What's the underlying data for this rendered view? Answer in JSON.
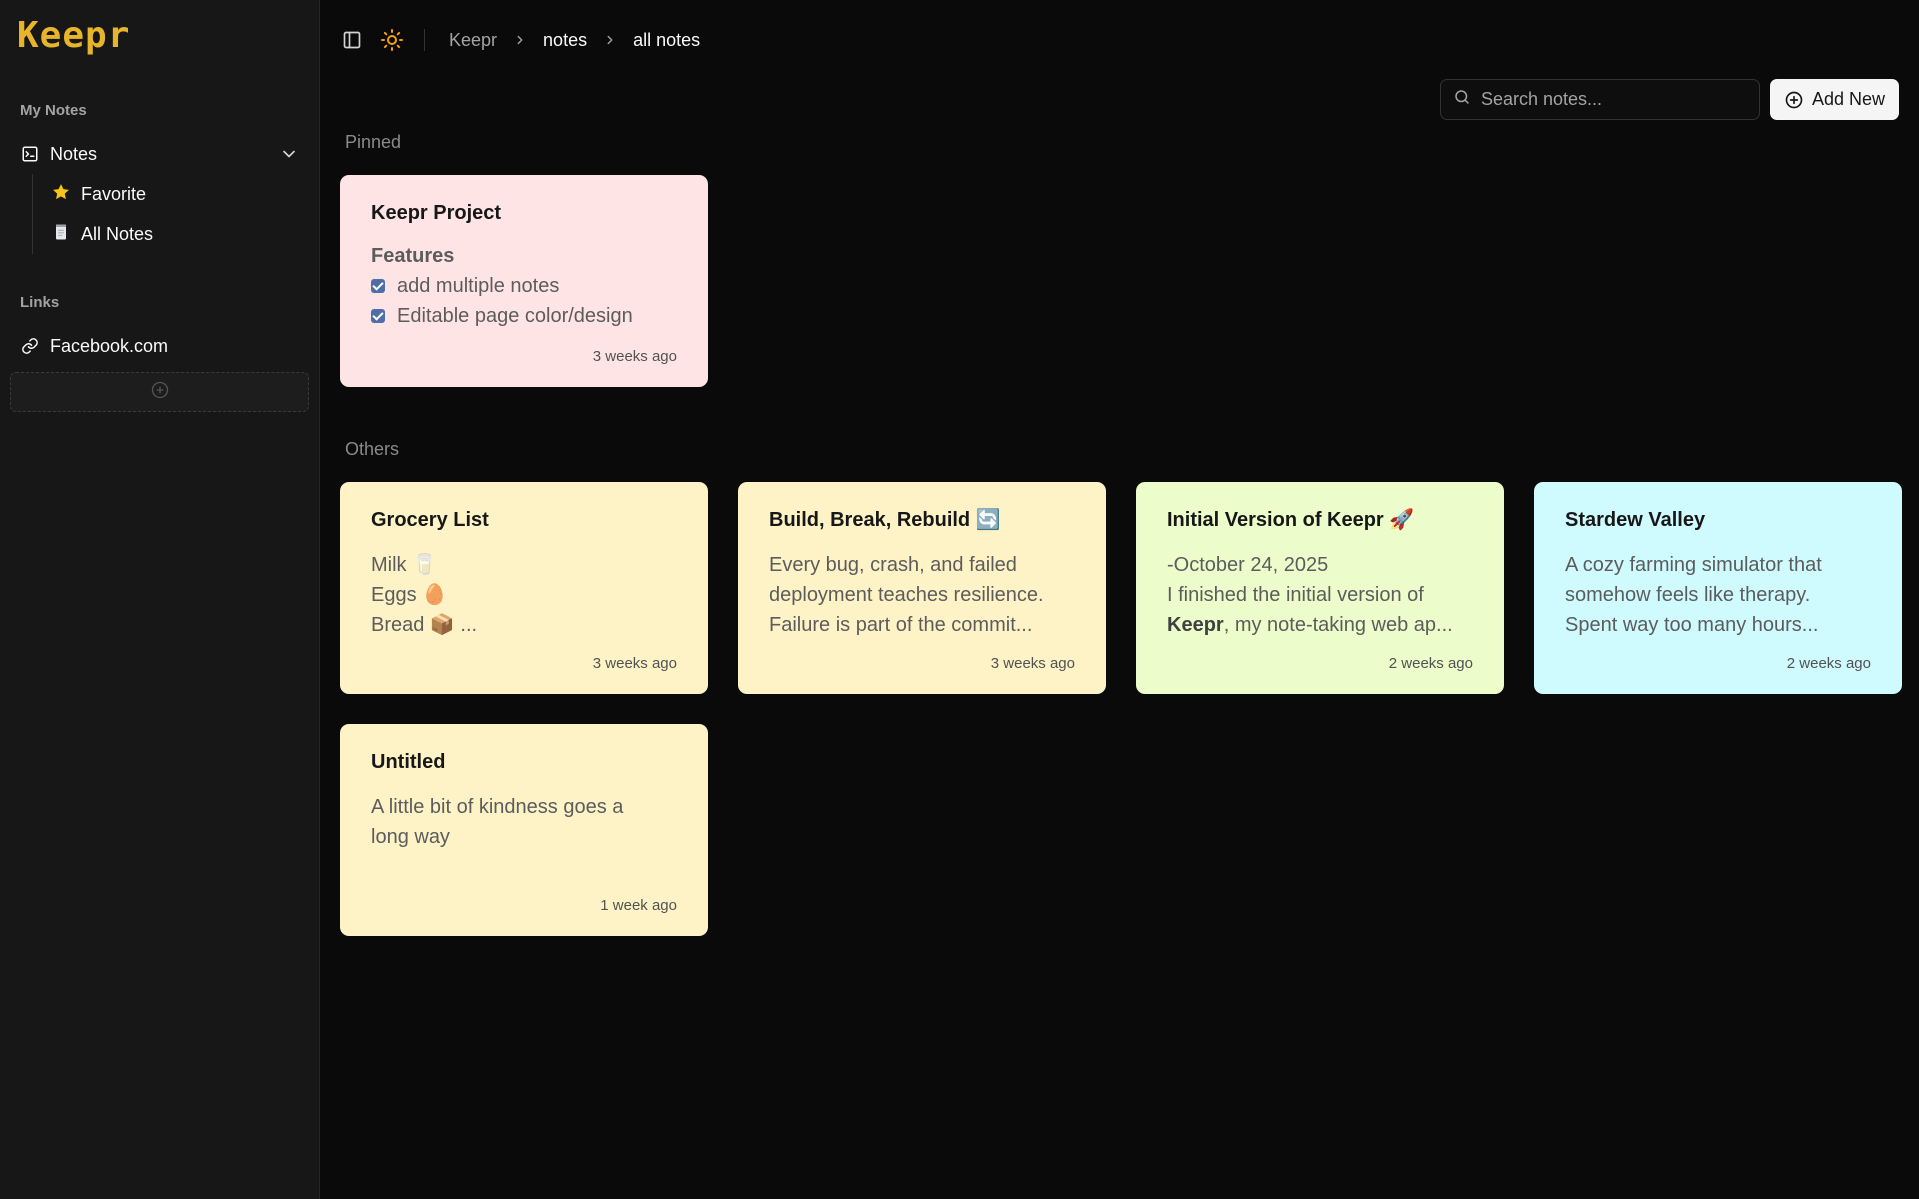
{
  "app": {
    "logo": "Keepr"
  },
  "sidebar": {
    "my_notes_label": "My Notes",
    "notes_label": "Notes",
    "favorite_label": "Favorite",
    "all_notes_label": "All Notes",
    "links_label": "Links",
    "links": [
      {
        "label": "Facebook.com"
      }
    ],
    "accent_color": "#e8b52a"
  },
  "breadcrumb": [
    "Keepr",
    "notes",
    "all notes"
  ],
  "search": {
    "placeholder": "Search notes..."
  },
  "toolbar": {
    "add_label": "Add New"
  },
  "groups": {
    "pinned": "Pinned",
    "others": "Others"
  },
  "pinned": [
    {
      "title": "Keepr Project",
      "heading": "Features",
      "checklist": [
        "add multiple notes",
        "Editable page color/design"
      ],
      "time": "3 weeks ago",
      "color": "#ffe4e6"
    }
  ],
  "notes": [
    {
      "title": "Grocery List",
      "lines": [
        "Milk 🥛",
        "Eggs 🥚",
        "Bread 📦 ..."
      ],
      "time": "3 weeks ago",
      "color": "#fef3c7"
    },
    {
      "title": "Build, Break, Rebuild 🔄",
      "lines": [
        "Every bug, crash, and failed",
        "deployment teaches resilience.",
        "Failure is part of the commit..."
      ],
      "time": "3 weeks ago",
      "color": "#fef3c7"
    },
    {
      "title": "Initial Version of Keepr 🚀",
      "lines": [
        "-October 24, 2025",
        "I finished the initial version of",
        "Keepr",
        ", my note-taking web ap..."
      ],
      "time": "2 weeks ago",
      "color": "#ecfccb"
    },
    {
      "title": "Stardew Valley",
      "lines": [
        "A cozy farming simulator that",
        "somehow feels like therapy.",
        "Spent way too many hours..."
      ],
      "time": "2 weeks ago",
      "color": "#cffafe"
    },
    {
      "title": "Untitled",
      "lines": [
        "A little bit of kindness goes a",
        "long way"
      ],
      "time": "1 week ago",
      "color": "#fef3c7"
    }
  ]
}
